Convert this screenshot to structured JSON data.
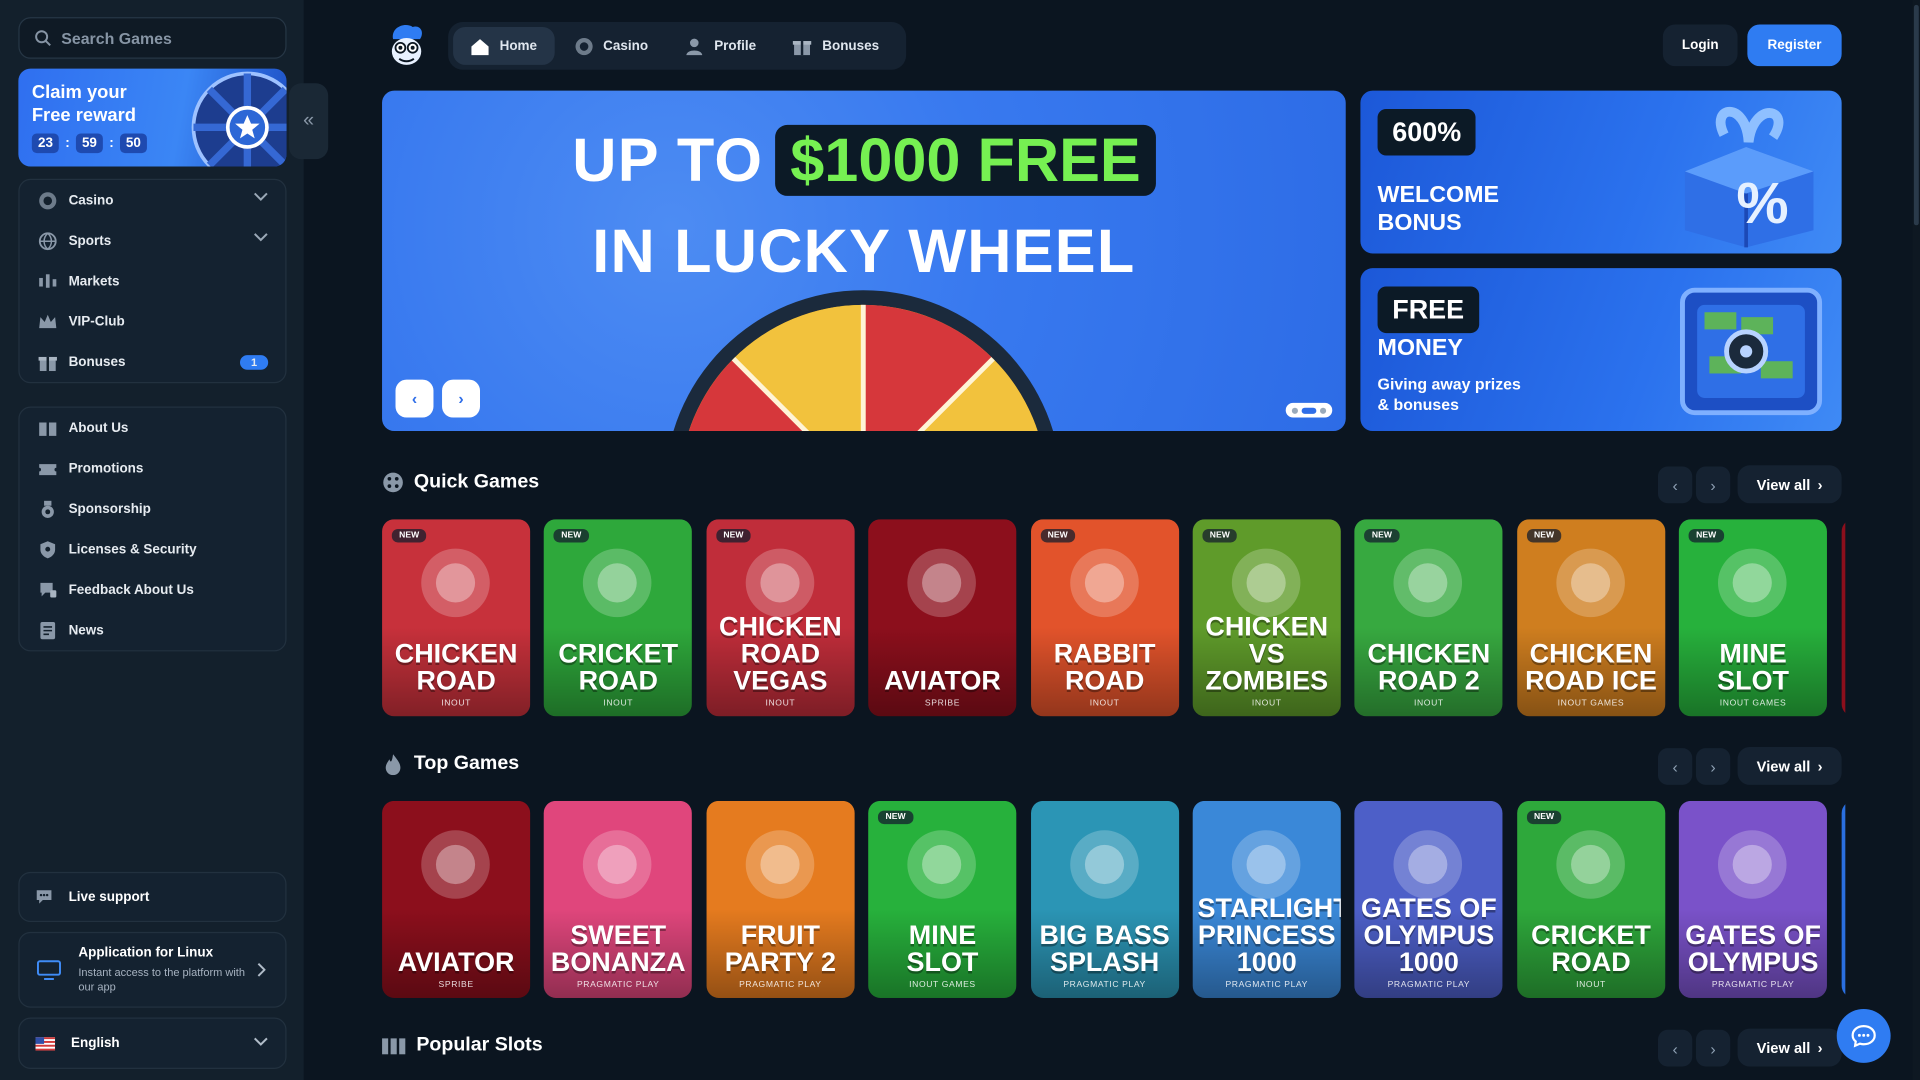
{
  "sidebar": {
    "search_placeholder": "Search Games",
    "claim": {
      "title": "Claim your Free reward",
      "hours": "23",
      "minutes": "59",
      "seconds": "50",
      "sep": ":"
    },
    "collapse_glyph": "«",
    "menu_main": [
      {
        "label": "Casino",
        "icon": "casino-chip-icon",
        "has_chevron": true
      },
      {
        "label": "Sports",
        "icon": "globe-ball-icon",
        "has_chevron": true
      },
      {
        "label": "Markets",
        "icon": "candles-icon"
      },
      {
        "label": "VIP-Club",
        "icon": "crown-icon"
      },
      {
        "label": "Bonuses",
        "icon": "gift-icon",
        "badge": "1"
      }
    ],
    "menu_info": [
      {
        "label": "About Us",
        "icon": "book-icon"
      },
      {
        "label": "Promotions",
        "icon": "ticket-icon"
      },
      {
        "label": "Sponsorship",
        "icon": "medal-icon"
      },
      {
        "label": "Licenses & Security",
        "icon": "shield-icon"
      },
      {
        "label": "Feedback About Us",
        "icon": "feedback-icon"
      },
      {
        "label": "News",
        "icon": "newspaper-icon"
      }
    ],
    "live_support": "Live support",
    "app": {
      "title": "Application for Linux",
      "desc": "Instant access to the platform with our app"
    },
    "language": "English"
  },
  "header": {
    "nav": [
      {
        "label": "Home",
        "icon": "home-icon",
        "active": true
      },
      {
        "label": "Casino",
        "icon": "casino-chip-icon"
      },
      {
        "label": "Profile",
        "icon": "user-icon"
      },
      {
        "label": "Bonuses",
        "icon": "gift-icon"
      }
    ],
    "login": "Login",
    "register": "Register"
  },
  "hero": {
    "line1_a": "UP TO",
    "line1_b": "$1000 FREE",
    "line2": "IN LUCKY WHEEL",
    "prev": "‹",
    "next": "›"
  },
  "promos": [
    {
      "tag": "600%",
      "big": "WELCOME BONUS",
      "sub": ""
    },
    {
      "tag": "FREE",
      "big": "MONEY",
      "sub": "Giving away prizes & bonuses"
    }
  ],
  "sections": {
    "quick": {
      "title": "Quick Games",
      "view_all": "View all"
    },
    "top": {
      "title": "Top Games",
      "view_all": "View all"
    },
    "popular": {
      "title": "Popular Slots",
      "view_all": "View all"
    }
  },
  "quick_games": [
    {
      "name": "CHICKEN ROAD",
      "provider": "INOUT",
      "new": "NEW",
      "bg": "#c7313b"
    },
    {
      "name": "CRICKET ROAD",
      "provider": "INOUT",
      "new": "NEW",
      "bg": "#2ea83b"
    },
    {
      "name": "CHICKEN ROAD VEGAS",
      "provider": "INOUT",
      "new": "NEW",
      "bg": "#c02d3a"
    },
    {
      "name": "AVIATOR",
      "provider": "SPRIBE",
      "new": "",
      "bg": "#8c0f1c"
    },
    {
      "name": "RABBIT ROAD",
      "provider": "INOUT",
      "new": "NEW",
      "bg": "#e2532b"
    },
    {
      "name": "CHICKEN VS ZOMBIES",
      "provider": "INOUT",
      "new": "NEW",
      "bg": "#5f9b2a"
    },
    {
      "name": "CHICKEN ROAD 2",
      "provider": "INOUT",
      "new": "NEW",
      "bg": "#37a940"
    },
    {
      "name": "CHICKEN ROAD ICE",
      "provider": "INOUT GAMES",
      "new": "NEW",
      "bg": "#cf7e1f"
    },
    {
      "name": "MINE SLOT",
      "provider": "INOUT GAMES",
      "new": "NEW",
      "bg": "#27b13c"
    }
  ],
  "top_games": [
    {
      "name": "AVIATOR",
      "provider": "SPRIBE",
      "new": "",
      "bg": "#8c0f1c"
    },
    {
      "name": "SWEET BONANZA",
      "provider": "PRAGMATIC PLAY",
      "new": "",
      "bg": "#e0467c"
    },
    {
      "name": "FRUIT PARTY 2",
      "provider": "PRAGMATIC PLAY",
      "new": "",
      "bg": "#e57b1f"
    },
    {
      "name": "MINE SLOT",
      "provider": "INOUT GAMES",
      "new": "NEW",
      "bg": "#27b13c"
    },
    {
      "name": "BIG BASS SPLASH",
      "provider": "PRAGMATIC PLAY",
      "new": "",
      "bg": "#2b95b5"
    },
    {
      "name": "STARLIGHT PRINCESS 1000",
      "provider": "PRAGMATIC PLAY",
      "new": "",
      "bg": "#3a88d8"
    },
    {
      "name": "GATES OF OLYMPUS 1000",
      "provider": "PRAGMATIC PLAY",
      "new": "",
      "bg": "#4d5fc8"
    },
    {
      "name": "CRICKET ROAD",
      "provider": "INOUT",
      "new": "NEW",
      "bg": "#2ea83b"
    },
    {
      "name": "GATES OF OLYMPUS",
      "provider": "PRAGMATIC PLAY",
      "new": "",
      "bg": "#7a52c9"
    }
  ]
}
